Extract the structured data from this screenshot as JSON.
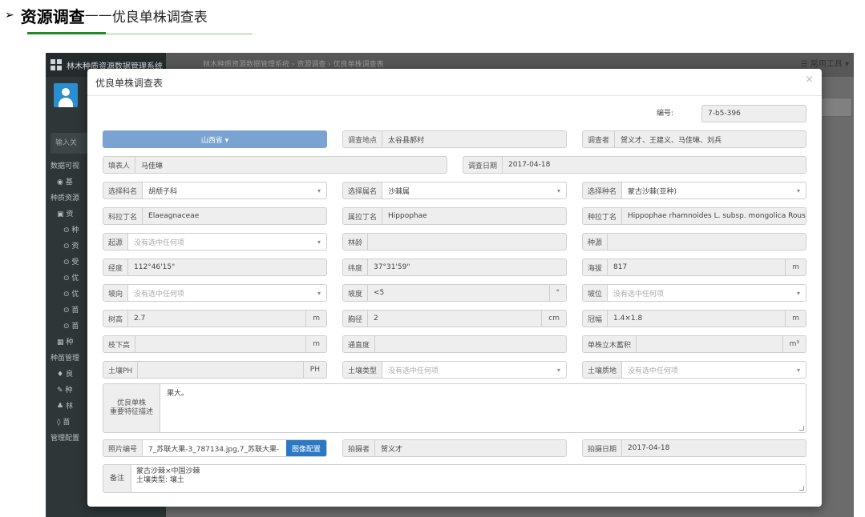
{
  "heading": {
    "arrow": "➢",
    "bold": "资源调查",
    "dash": "——",
    "rest": "优良单株调查表"
  },
  "app": {
    "sidebar": {
      "title": "林木种质资源数据管理系统",
      "search_placeholder": "输入关",
      "items": [
        "数据可视",
        "基",
        "种质资源",
        "资",
        "种",
        "资",
        "受",
        "优",
        "优",
        "苗",
        "苗",
        "种",
        "种苗管理",
        "良",
        "种",
        "林",
        "苗",
        "管理配置"
      ]
    },
    "topbar": {
      "breadcrumb": "林木种质资源数据管理系统 › 资源调查 › 优良单株调查表",
      "tools": "☰ 常用工具 ▾"
    }
  },
  "modal": {
    "title": "优良单株调查表",
    "close": "×",
    "number": {
      "label": "编号:",
      "value": "7-b5-396"
    },
    "province_button": "山西省 ▾",
    "survey_place": {
      "label": "调查地点",
      "value": "太谷县郝村"
    },
    "surveyor": {
      "label": "调查者",
      "value": "贺义才、王建义、马佳琳、刘兵"
    },
    "filler": {
      "label": "填表人",
      "value": "马佳琳"
    },
    "survey_date": {
      "label": "调查日期",
      "value": "2017-04-18"
    },
    "family": {
      "label": "选择科名",
      "value": "胡颓子科"
    },
    "genus": {
      "label": "选择属名",
      "value": "沙棘属"
    },
    "species": {
      "label": "选择种名",
      "value": "蒙古沙棘(亚种)"
    },
    "family_latin": {
      "label": "科拉丁名",
      "value": "Elaeagnaceae"
    },
    "genus_latin": {
      "label": "属拉丁名",
      "value": "Hippophae"
    },
    "species_latin": {
      "label": "种拉丁名",
      "value": "Hippophae rhamnoides L. subsp. mongolica Rousi"
    },
    "origin": {
      "label": "起源",
      "value": "没有选中任何项"
    },
    "age": {
      "label": "林龄",
      "value": ""
    },
    "provenance": {
      "label": "种源",
      "value": ""
    },
    "longitude": {
      "label": "经度",
      "value": "112°46'15\""
    },
    "latitude": {
      "label": "纬度",
      "value": "37°31'59\""
    },
    "altitude": {
      "label": "海拔",
      "value": "817",
      "unit": "m"
    },
    "aspect": {
      "label": "坡向",
      "value": "没有选中任何项"
    },
    "slope": {
      "label": "坡度",
      "value": "<5",
      "unit": "°"
    },
    "slope_pos": {
      "label": "坡位",
      "value": "没有选中任何项"
    },
    "height": {
      "label": "树高",
      "value": "2.7",
      "unit": "m"
    },
    "dbh": {
      "label": "胸径",
      "value": "2",
      "unit": "cm"
    },
    "crown": {
      "label": "冠幅",
      "value": "1.4×1.8",
      "unit": "m"
    },
    "clear_bole": {
      "label": "枝下高",
      "value": "",
      "unit": "m"
    },
    "straightness": {
      "label": "通直度",
      "value": ""
    },
    "volume": {
      "label": "单株立木蓄积",
      "value": "",
      "unit": "m³"
    },
    "soil_ph": {
      "label": "土壤PH",
      "value": "",
      "unit": "PH"
    },
    "soil_type": {
      "label": "土壤类型",
      "value": "没有选中任何项"
    },
    "soil_texture": {
      "label": "土壤质地",
      "value": "没有选中任何项"
    },
    "traits": {
      "label1": "优良单株",
      "label2": "重要特征描述",
      "value": "果大。"
    },
    "photo_no": {
      "label": "照片编号",
      "value": "7_苏联大果-3_787134.jpg,7_苏联大果-",
      "button": "图像配置"
    },
    "photographer": {
      "label": "拍摄者",
      "value": "贺义才"
    },
    "photo_date": {
      "label": "拍摄日期",
      "value": "2017-04-18"
    },
    "remark": {
      "label": "备注",
      "line1": "蒙古沙棘×中国沙棘",
      "line2": "土壤类型: 壤土"
    }
  }
}
